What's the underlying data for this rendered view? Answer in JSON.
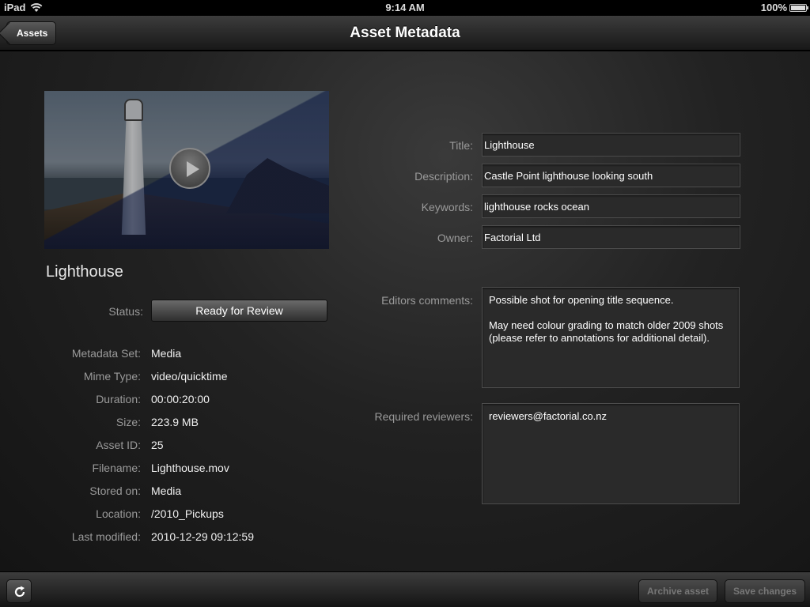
{
  "status_bar": {
    "device": "iPad",
    "time": "9:14 AM",
    "battery": "100%"
  },
  "nav": {
    "back_label": "Assets",
    "title": "Asset Metadata"
  },
  "asset": {
    "name": "Lighthouse",
    "status_label": "Status:",
    "status_value": "Ready for Review",
    "details": [
      {
        "label": "Metadata  Set:",
        "value": "Media"
      },
      {
        "label": "Mime Type:",
        "value": "video/quicktime"
      },
      {
        "label": "Duration:",
        "value": "00:00:20:00"
      },
      {
        "label": "Size:",
        "value": "223.9 MB"
      },
      {
        "label": "Asset ID:",
        "value": "25"
      },
      {
        "label": "Filename:",
        "value": "Lighthouse.mov"
      },
      {
        "label": "Stored on:",
        "value": "Media"
      },
      {
        "label": "Location:",
        "value": "/2010_Pickups"
      },
      {
        "label": "Last modified:",
        "value": "2010-12-29 09:12:59"
      }
    ]
  },
  "form": {
    "title": {
      "label": "Title:",
      "value": "Lighthouse"
    },
    "description": {
      "label": "Description:",
      "value": "Castle Point lighthouse looking south"
    },
    "keywords": {
      "label": "Keywords:",
      "value": "lighthouse rocks ocean"
    },
    "owner": {
      "label": "Owner:",
      "value": "Factorial Ltd"
    },
    "editors_comments": {
      "label": "Editors comments:",
      "value": "Possible shot for opening title sequence.\n\nMay need colour grading to match older 2009 shots (please refer to annotations for additional detail)."
    },
    "required_reviewers": {
      "label": "Required reviewers:",
      "value": "reviewers@factorial.co.nz"
    }
  },
  "toolbar": {
    "refresh_icon": "refresh-icon",
    "archive_label": "Archive asset",
    "save_label": "Save changes"
  }
}
